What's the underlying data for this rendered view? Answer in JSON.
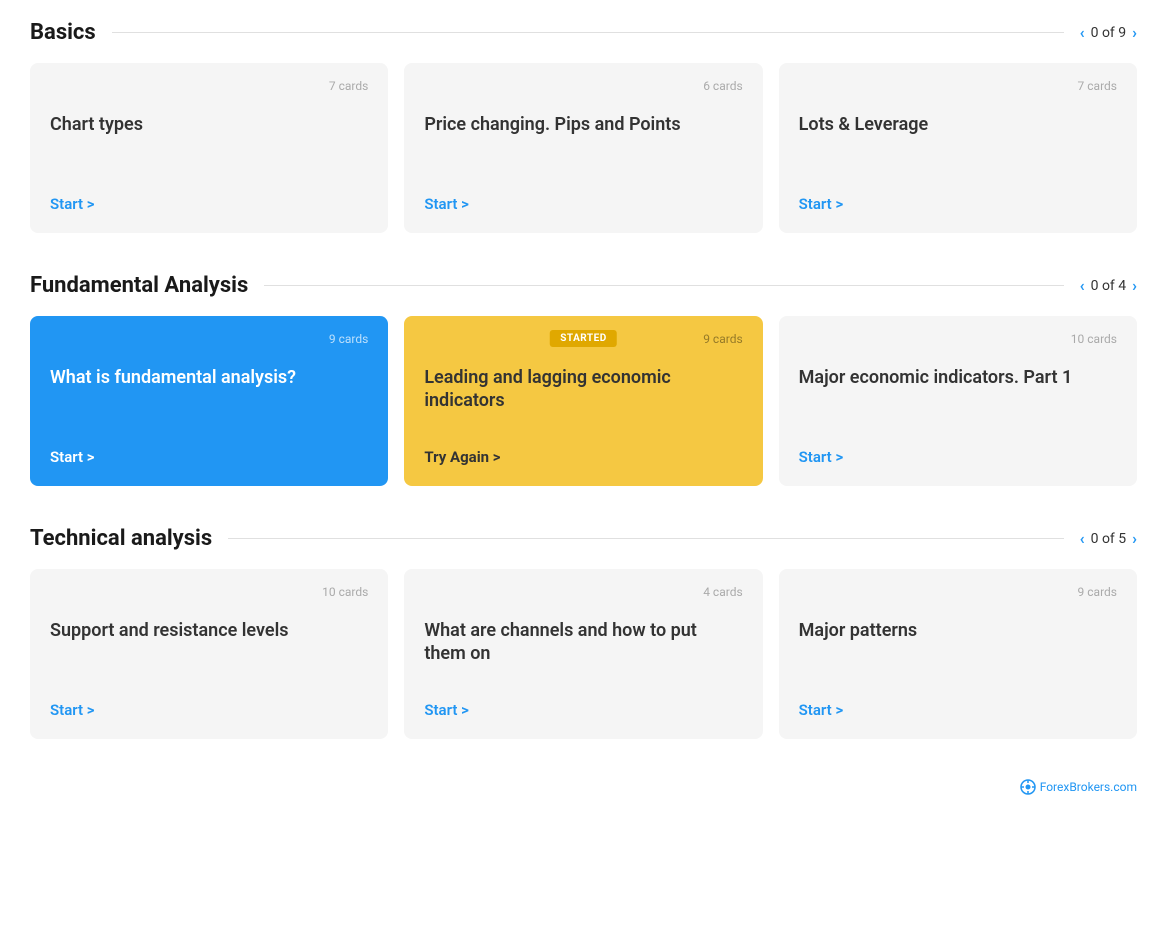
{
  "sections": [
    {
      "id": "basics",
      "title": "Basics",
      "progress": "0 of 9",
      "cards": [
        {
          "id": "chart-types",
          "count": "7 cards",
          "title": "Chart types",
          "linkText": "Start >",
          "style": "default",
          "badge": null
        },
        {
          "id": "price-changing",
          "count": "6 cards",
          "title": "Price changing. Pips and Points",
          "linkText": "Start >",
          "style": "default",
          "badge": null
        },
        {
          "id": "lots-leverage",
          "count": "7 cards",
          "title": "Lots & Leverage",
          "linkText": "Start >",
          "style": "default",
          "badge": null
        }
      ]
    },
    {
      "id": "fundamental-analysis",
      "title": "Fundamental Analysis",
      "progress": "0 of 4",
      "cards": [
        {
          "id": "what-is-fundamental",
          "count": "9 cards",
          "title": "What is fundamental analysis?",
          "linkText": "Start >",
          "style": "blue",
          "badge": null
        },
        {
          "id": "leading-lagging",
          "count": "9 cards",
          "title": "Leading and lagging economic indicators",
          "linkText": "Try Again >",
          "style": "yellow",
          "badge": "STARTED"
        },
        {
          "id": "major-economic",
          "count": "10 cards",
          "title": "Major economic indicators. Part 1",
          "linkText": "Start >",
          "style": "default",
          "badge": null
        }
      ]
    },
    {
      "id": "technical-analysis",
      "title": "Technical analysis",
      "progress": "0 of 5",
      "cards": [
        {
          "id": "support-resistance",
          "count": "10 cards",
          "title": "Support and resistance levels",
          "linkText": "Start >",
          "style": "default",
          "badge": null
        },
        {
          "id": "channels",
          "count": "4 cards",
          "title": "What are channels and how to put them on",
          "linkText": "Start >",
          "style": "default",
          "badge": null
        },
        {
          "id": "major-patterns",
          "count": "9 cards",
          "title": "Major patterns",
          "linkText": "Start >",
          "style": "default",
          "badge": null
        }
      ]
    }
  ],
  "footer": {
    "brand": "ForexBrokers.com"
  },
  "nav": {
    "prev": "‹",
    "next": "›"
  }
}
